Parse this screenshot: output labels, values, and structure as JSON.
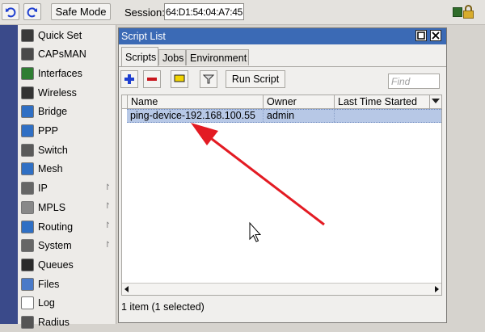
{
  "toolbar": {
    "undo_icon": "undo-icon",
    "redo_icon": "redo-icon",
    "safe_mode_label": "Safe Mode",
    "session_label": "Session:",
    "session_value": "64:D1:54:04:A7:45"
  },
  "menu": {
    "items": [
      {
        "label": "Quick Set",
        "icon": "quickset-icon",
        "color": "#3a3a3a",
        "has_submenu": false
      },
      {
        "label": "CAPsMAN",
        "icon": "capsman-icon",
        "color": "#4a4a4a",
        "has_submenu": false
      },
      {
        "label": "Interfaces",
        "icon": "interfaces-icon",
        "color": "#2e7d32",
        "has_submenu": false
      },
      {
        "label": "Wireless",
        "icon": "wireless-icon",
        "color": "#333333",
        "has_submenu": false
      },
      {
        "label": "Bridge",
        "icon": "bridge-icon",
        "color": "#2f6fc4",
        "has_submenu": false
      },
      {
        "label": "PPP",
        "icon": "ppp-icon",
        "color": "#2f6fc4",
        "has_submenu": false
      },
      {
        "label": "Switch",
        "icon": "switch-icon",
        "color": "#5a5a5a",
        "has_submenu": false
      },
      {
        "label": "Mesh",
        "icon": "mesh-icon",
        "color": "#2f6fc4",
        "has_submenu": false
      },
      {
        "label": "IP",
        "icon": "ip-icon",
        "color": "#666666",
        "has_submenu": true
      },
      {
        "label": "MPLS",
        "icon": "mpls-icon",
        "color": "#888888",
        "has_submenu": true
      },
      {
        "label": "Routing",
        "icon": "routing-icon",
        "color": "#2f6fc4",
        "has_submenu": true
      },
      {
        "label": "System",
        "icon": "system-icon",
        "color": "#666666",
        "has_submenu": true
      },
      {
        "label": "Queues",
        "icon": "queues-icon",
        "color": "#2a2a2a",
        "has_submenu": false
      },
      {
        "label": "Files",
        "icon": "files-icon",
        "color": "#4a7ac8",
        "has_submenu": false
      },
      {
        "label": "Log",
        "icon": "log-icon",
        "color": "#ffffff",
        "has_submenu": false
      },
      {
        "label": "Radius",
        "icon": "radius-icon",
        "color": "#555555",
        "has_submenu": false
      }
    ]
  },
  "window": {
    "title": "Script List",
    "maximize_icon": "maximize-icon",
    "close_icon": "close-icon",
    "tabs": [
      {
        "label": "Scripts",
        "active": true
      },
      {
        "label": "Jobs",
        "active": false
      },
      {
        "label": "Environment",
        "active": false
      }
    ],
    "actions": {
      "add_icon": "add-icon",
      "remove_icon": "remove-icon",
      "comment_icon": "comment-icon",
      "filter_icon": "filter-icon",
      "run_script_label": "Run Script",
      "find_placeholder": "Find"
    },
    "table": {
      "columns": [
        "Name",
        "Owner",
        "Last Time Started"
      ],
      "rows": [
        {
          "name": "ping-device-192.168.100.55",
          "owner": "admin",
          "last_time_started": "",
          "selected": true
        }
      ]
    },
    "status_text": "1 item (1 selected)"
  },
  "colors": {
    "titlebar": "#3b6ab5",
    "selection": "#b7c8e6",
    "annotation_arrow": "#e31b23",
    "add": "#1f3fd0",
    "remove": "#c8161d",
    "comment": "#f2d400"
  }
}
